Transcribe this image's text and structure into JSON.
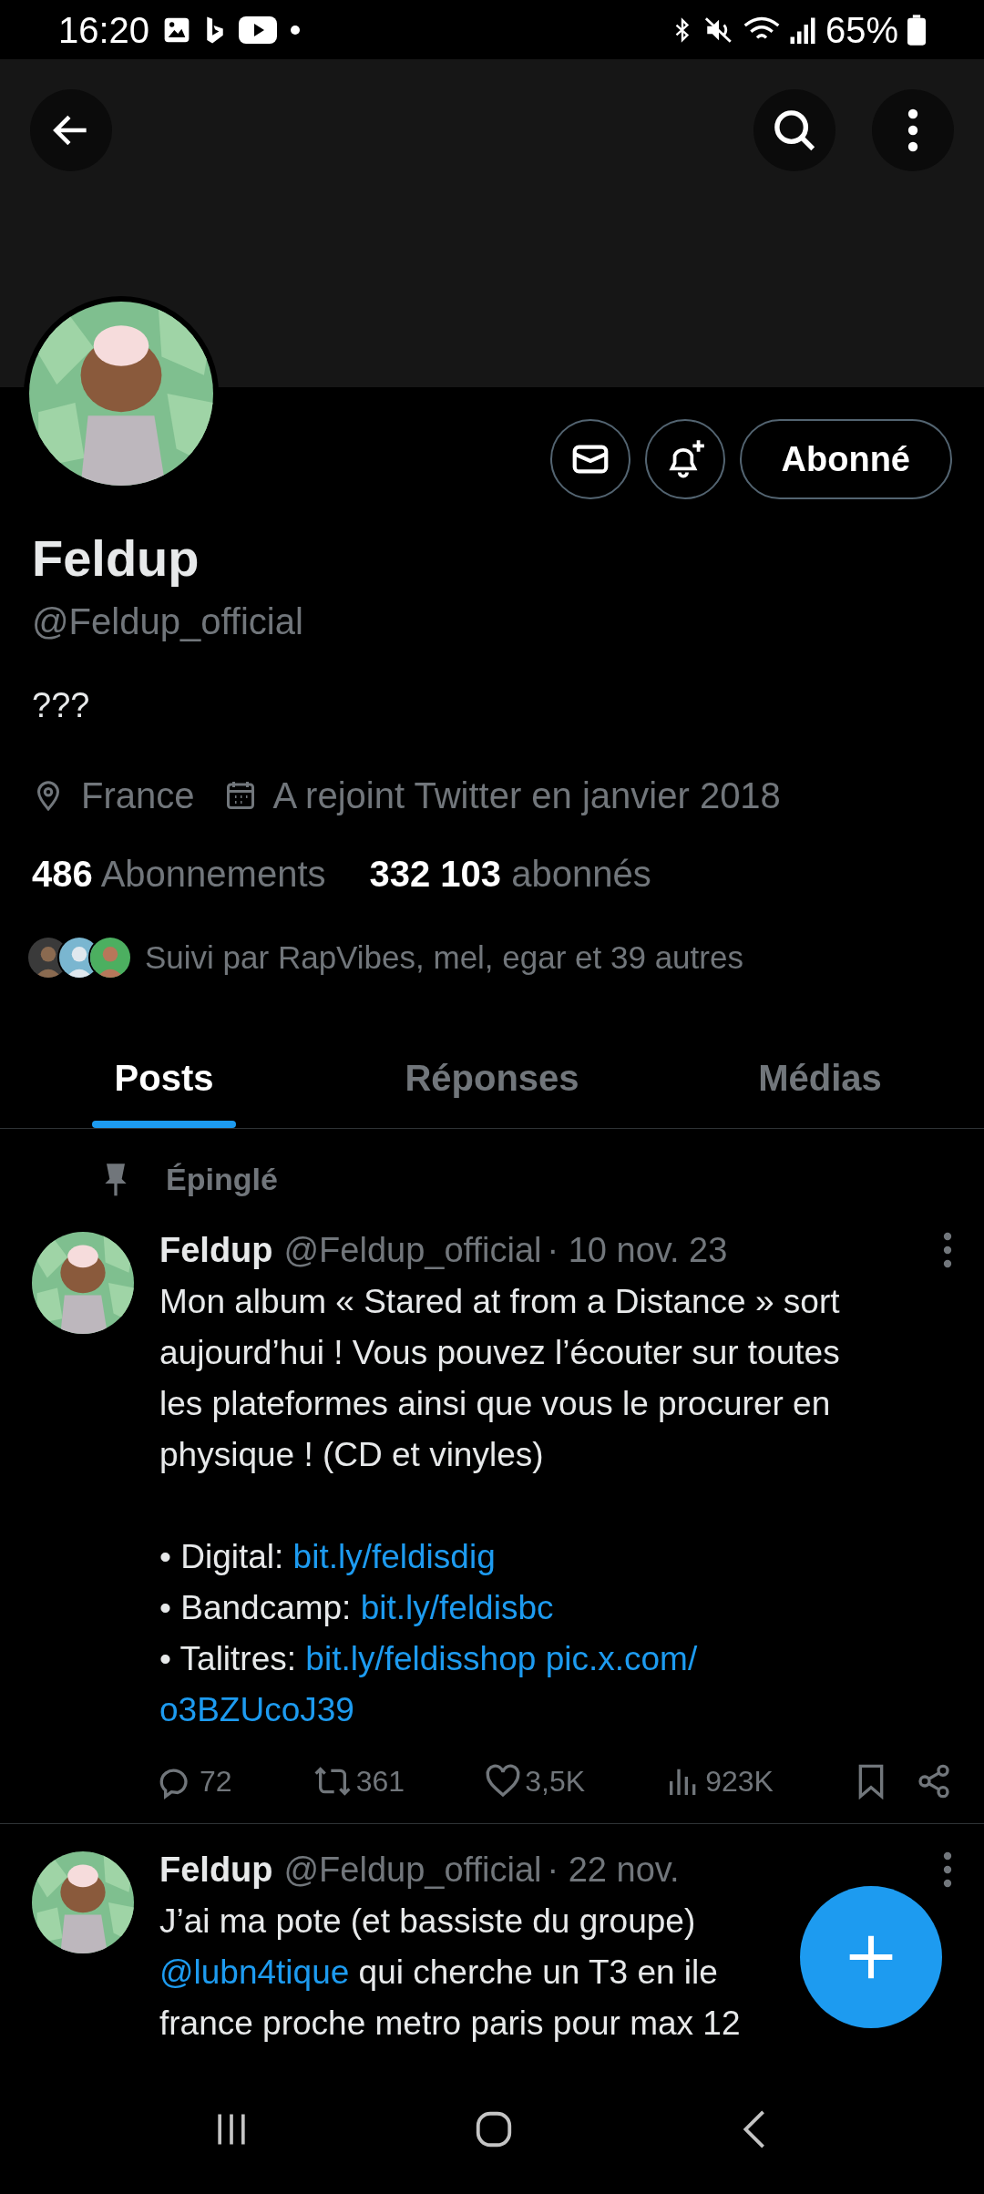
{
  "status_bar": {
    "time": "16:20",
    "battery": "65%"
  },
  "profile": {
    "name": "Feldup",
    "handle": "@Feldup_official",
    "bio": "???",
    "location": "France",
    "joined": "A rejoint Twitter en janvier 2018",
    "following_count": "486",
    "following_label": "Abonnements",
    "followers_count": "332 103",
    "followers_label": "abonnés",
    "followed_by": "Suivi par RapVibes, mel, egar et 39 autres",
    "follow_button": "Abonné"
  },
  "tabs": [
    {
      "label": "Posts",
      "selected": true
    },
    {
      "label": "Réponses",
      "selected": false
    },
    {
      "label": "Médias",
      "selected": false
    }
  ],
  "posts": [
    {
      "pinned": true,
      "pinned_label": "Épinglé",
      "name": "Feldup",
      "handle": "@Feldup_official",
      "date": "· 10 nov. 23",
      "paragraphs": [
        [
          [
            {
              "text": "Mon album « Stared at from a Distance » sort",
              "link": false
            }
          ],
          [
            {
              "text": "aujourd’hui ! Vous pouvez l’écouter sur toutes",
              "link": false
            }
          ],
          [
            {
              "text": "les plateformes ainsi que vous le procurer en",
              "link": false
            }
          ],
          [
            {
              "text": "physique ! (CD et vinyles)",
              "link": false
            }
          ]
        ],
        [
          [
            {
              "text": "• Digital: ",
              "link": false
            },
            {
              "text": "bit.ly/feldisdig",
              "link": true
            }
          ],
          [
            {
              "text": "• Bandcamp: ",
              "link": false
            },
            {
              "text": "bit.ly/feldisbc",
              "link": true
            }
          ],
          [
            {
              "text": "• Talitres: ",
              "link": false
            },
            {
              "text": "bit.ly/feldisshop",
              "link": true
            },
            {
              "text": "pic.x.com/",
              "link": true
            }
          ],
          [
            {
              "text": "o3BZUcoJ39",
              "link": true
            }
          ]
        ]
      ],
      "stats": {
        "replies": "72",
        "reposts": "361",
        "likes": "3,5K",
        "views": "923K"
      }
    },
    {
      "pinned": false,
      "name": "Feldup",
      "handle": "@Feldup_official",
      "date": "· 22 nov.",
      "paragraphs": [
        [
          [
            {
              "text": "J’ai ma pote (et bassiste du groupe)",
              "link": false
            }
          ],
          [
            {
              "text": "@lubn4tique",
              "link": true
            },
            {
              "text": " qui cherche un T3 en ile",
              "link": false
            }
          ],
          [
            {
              "text": "france proche metro paris pour max 12",
              "link": false
            }
          ]
        ]
      ]
    }
  ]
}
